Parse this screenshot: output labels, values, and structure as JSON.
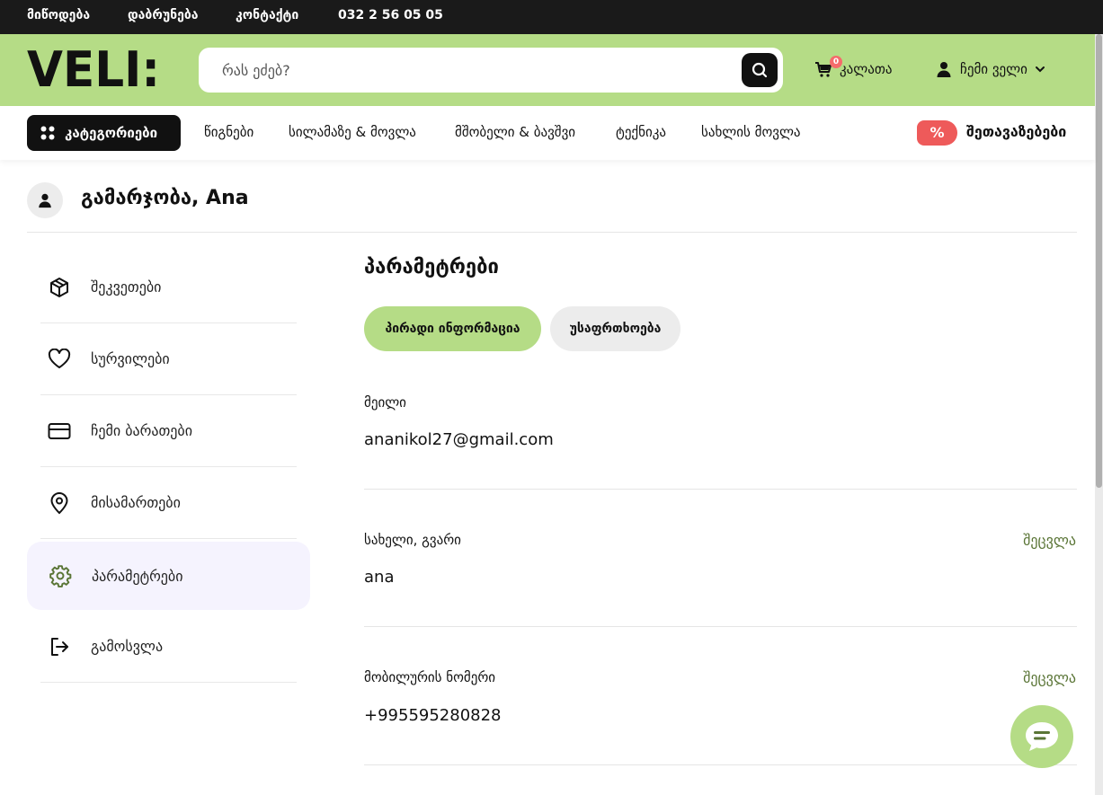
{
  "topbar": {
    "links": [
      "მიწოდება",
      "დაბრუნება",
      "კონტაქტი"
    ],
    "phone": "032 2 56 05 05"
  },
  "header": {
    "logo_text": "VELI:",
    "search_placeholder": "რას ეძებ?",
    "cart_label": "კალათა",
    "cart_count": "0",
    "account_label": "ჩემი ველი"
  },
  "nav": {
    "categories_label": "კატეგორიები",
    "items": [
      "წიგნები",
      "სილამაზე & მოვლა",
      "მშობელი & ბავშვი",
      "ტექნიკა",
      "სახლის მოვლა"
    ],
    "promo_symbol": "%",
    "promo_label": "შეთავაზებები"
  },
  "greeting": "გამარჯობა, Ana",
  "sidebar": {
    "items": [
      {
        "label": "შეკვეთები",
        "icon": "box-icon"
      },
      {
        "label": "სურვილები",
        "icon": "heart-icon"
      },
      {
        "label": "ჩემი ბარათები",
        "icon": "card-icon"
      },
      {
        "label": "მისამართები",
        "icon": "location-pin-icon"
      },
      {
        "label": "პარამეტრები",
        "icon": "gear-icon"
      },
      {
        "label": "გამოსვლა",
        "icon": "logout-icon"
      }
    ],
    "active_index": 4
  },
  "main": {
    "title": "პარამეტრები",
    "tabs": [
      "პირადი ინფორმაცია",
      "უსაფრთხოება"
    ],
    "active_tab": 0,
    "fields": [
      {
        "label": "მეილი",
        "value": "ananikol27@gmail.com",
        "edit": ""
      },
      {
        "label": "სახელი, გვარი",
        "value": "ana",
        "edit": "შეცვლა"
      },
      {
        "label": "მობილურის ნომერი",
        "value": "+995595280828",
        "edit": "შეცვლა"
      }
    ]
  },
  "colors": {
    "accent_green": "#b5dc86",
    "dark": "#1a1a1a",
    "promo_red": "#ee5a5a",
    "edit_link": "#5a7536",
    "active_bg": "#f5f3fe"
  }
}
